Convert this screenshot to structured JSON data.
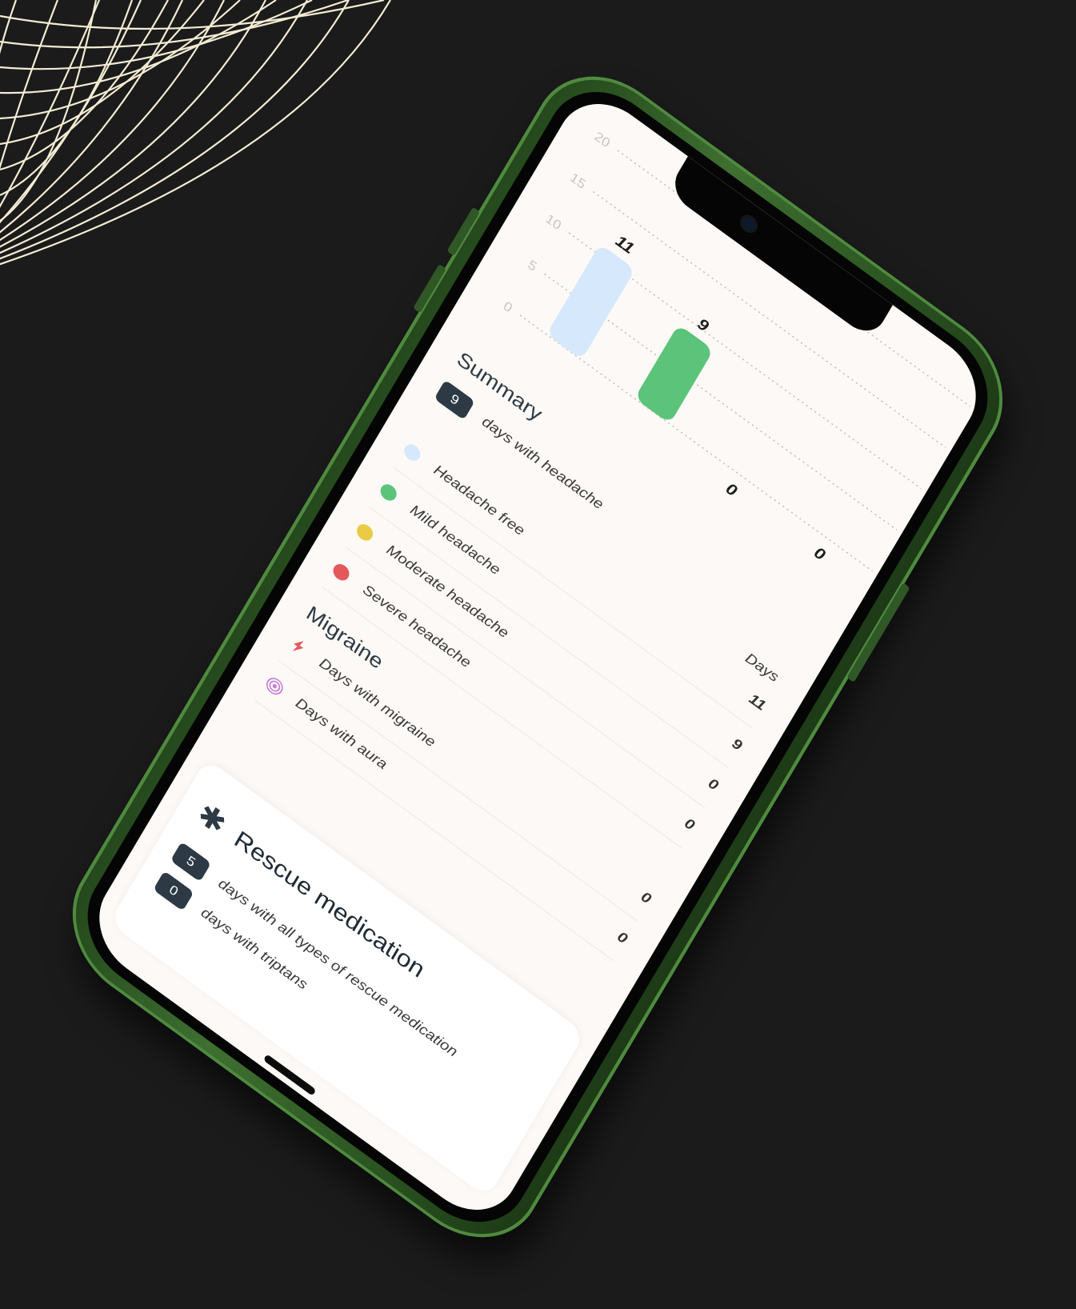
{
  "chart_data": {
    "type": "bar",
    "categories": [
      "Headache free",
      "Mild headache",
      "Moderate headache",
      "Severe headache"
    ],
    "values": [
      11,
      9,
      0,
      0
    ],
    "colors": [
      "#d6e8fb",
      "#5cc47a",
      "#eacb45",
      "#e5585a"
    ],
    "yticks": [
      0,
      5,
      10,
      15,
      20
    ],
    "ylim": [
      0,
      20
    ]
  },
  "summary": {
    "title": "Summary",
    "headache_days": {
      "count": "9",
      "label": "days with headache"
    },
    "days_header": "Days",
    "rows": [
      {
        "label": "Headache free",
        "value": "11",
        "color": "#d6e8fb"
      },
      {
        "label": "Mild headache",
        "value": "9",
        "color": "#5cc47a"
      },
      {
        "label": "Moderate headache",
        "value": "0",
        "color": "#eacb45"
      },
      {
        "label": "Severe headache",
        "value": "0",
        "color": "#e5585a"
      }
    ]
  },
  "migraine": {
    "title": "Migraine",
    "rows": [
      {
        "label": "Days with migraine",
        "value": "0",
        "icon": "lightning-icon"
      },
      {
        "label": "Days with aura",
        "value": "0",
        "icon": "aura-target-icon"
      }
    ]
  },
  "rescue": {
    "title": "Rescue medication",
    "icon": "asterisk-icon",
    "all_types": {
      "count": "5",
      "label": "days with all types of rescue medication"
    },
    "triptans": {
      "count": "0",
      "label": "days with triptans"
    }
  },
  "colors": {
    "phone_body": "#3e6f30",
    "background": "#1b1b1b",
    "pill": "#2d3a45"
  }
}
